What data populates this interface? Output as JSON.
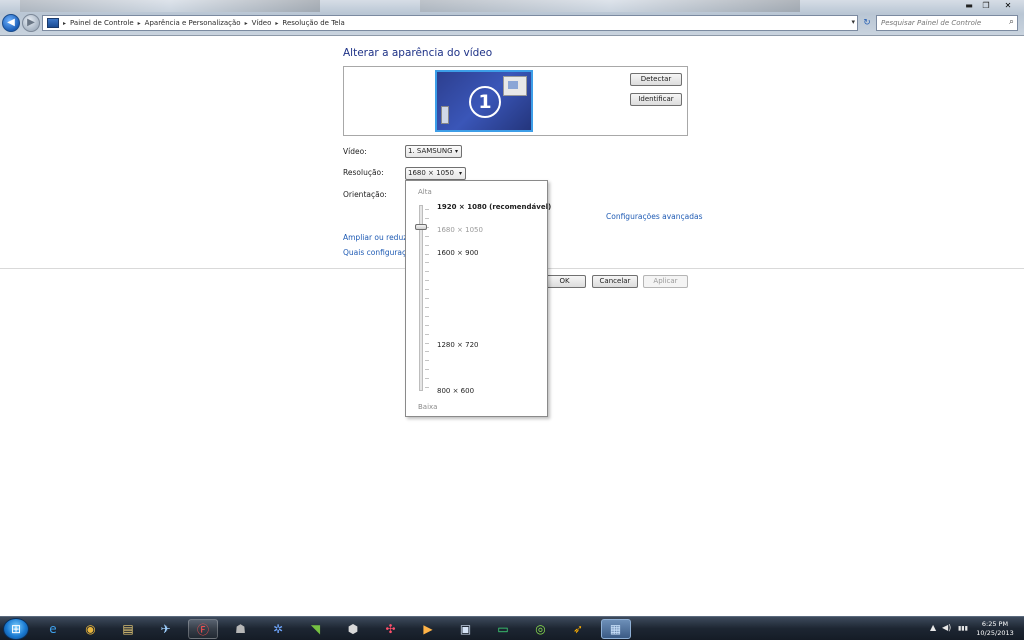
{
  "address_bar": {
    "crumbs": [
      "Painel de Controle",
      "Aparência e Personalização",
      "Vídeo",
      "Resolução de Tela"
    ]
  },
  "search": {
    "placeholder": "Pesquisar Painel de Controle"
  },
  "window_controls": {
    "minimize": "▬",
    "maximize": "❐",
    "close": "✕"
  },
  "icons": {
    "back": "◀",
    "forward": "▶",
    "refresh": "↻",
    "search": "⌕",
    "crumb_separator": "▸",
    "dropdown": "▾"
  },
  "main": {
    "heading": "Alterar a aparência do vídeo",
    "monitor_number": "1",
    "detect_button": "Detectar",
    "identify_button": "Identificar",
    "display_label": "Vídeo:",
    "display_value": "1. SAMSUNG",
    "resolution_label": "Resolução:",
    "resolution_value": "1680 × 1050",
    "orientation_label": "Orientação:",
    "advanced_link": "Configurações avançadas",
    "link_enlarge": "Ampliar ou reduzir",
    "link_settings": "Quais configuraçõ",
    "ok_button": "OK",
    "cancel_button": "Cancelar",
    "apply_button": "Aplicar"
  },
  "resolution_dropdown": {
    "high_label": "Alta",
    "low_label": "Baixa",
    "slider_position": 0.12,
    "options": [
      {
        "label": "1920 × 1080 (recomendável)",
        "kind": "recommended"
      },
      {
        "label": "1680 × 1050",
        "kind": "current"
      },
      {
        "label": "1600 × 900",
        "kind": "normal"
      },
      {
        "label": "1280 × 720",
        "kind": "normal"
      },
      {
        "label": "800 × 600",
        "kind": "normal"
      }
    ]
  },
  "taskbar": {
    "start_icon": "⊞",
    "apps": [
      {
        "name": "ie-icon",
        "glyph": "e",
        "color": "#3fa3f0"
      },
      {
        "name": "chrome-icon",
        "glyph": "◉",
        "color": "#e8b53c"
      },
      {
        "name": "explorer-icon",
        "glyph": "▤",
        "color": "#f1d27a"
      },
      {
        "name": "airplane-icon",
        "glyph": "✈",
        "color": "#9fd0ff"
      },
      {
        "name": "f-app-icon",
        "glyph": "Ⓕ",
        "color": "#ff5050"
      },
      {
        "name": "character-icon",
        "glyph": "☗",
        "color": "#b7b7b7"
      },
      {
        "name": "steam-icon",
        "glyph": "✲",
        "color": "#6fa7ff"
      },
      {
        "name": "nvidia-icon",
        "glyph": "◥",
        "color": "#76c142"
      },
      {
        "name": "cube-icon",
        "glyph": "⬢",
        "color": "#d9d9d9"
      },
      {
        "name": "molecule-icon",
        "glyph": "✣",
        "color": "#ff4f6b"
      },
      {
        "name": "media-player-icon",
        "glyph": "▶",
        "color": "#ffb347"
      },
      {
        "name": "disk-icon",
        "glyph": "▣",
        "color": "#d6e4f7"
      },
      {
        "name": "monitor-app-icon",
        "glyph": "▭",
        "color": "#3fe07a"
      },
      {
        "name": "razer-icon",
        "glyph": "◎",
        "color": "#8be04e"
      },
      {
        "name": "jet-icon",
        "glyph": "➶",
        "color": "#ffb000"
      },
      {
        "name": "display-settings-icon",
        "glyph": "▦",
        "color": "#cfe6ff"
      }
    ],
    "tray": {
      "up_arrow": "▲",
      "volume": "◀)",
      "signal": "▮▮▮"
    },
    "clock_time": "6:25 PM",
    "clock_date": "10/25/2013"
  }
}
